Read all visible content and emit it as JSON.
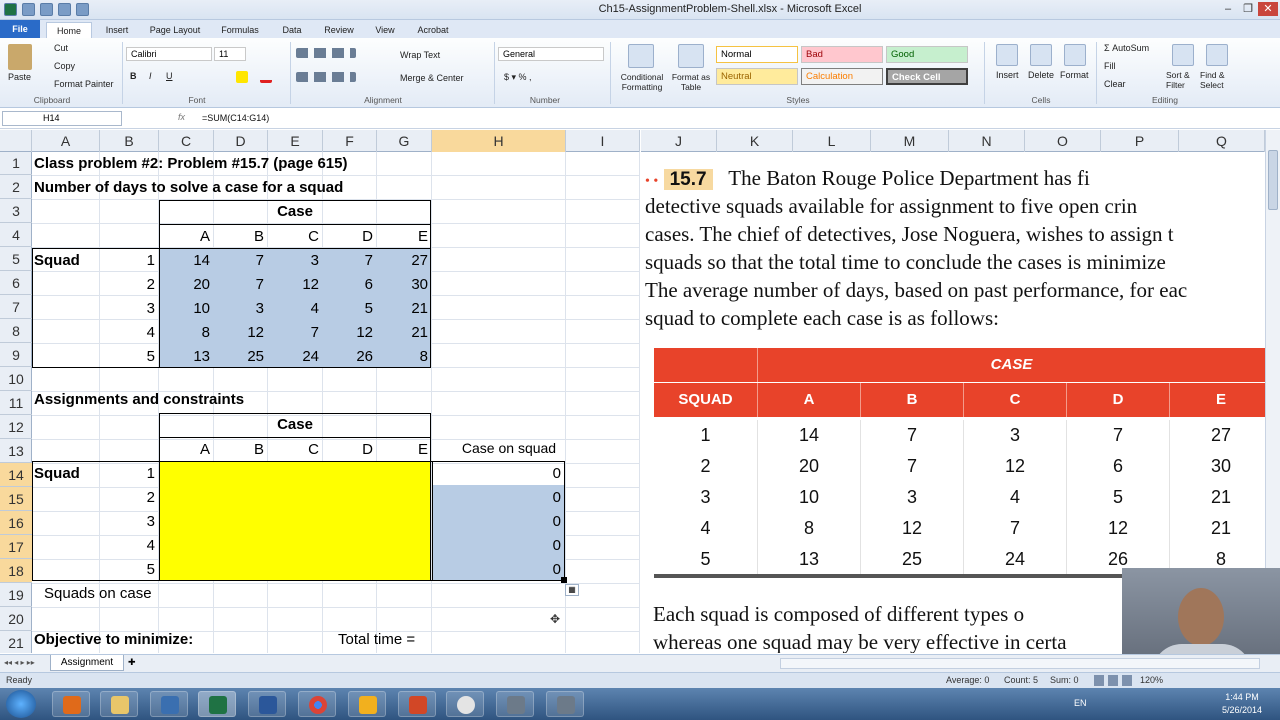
{
  "window": {
    "title": "Ch15-AssignmentProblem-Shell.xlsx - Microsoft Excel"
  },
  "tabs": [
    "File",
    "Home",
    "Insert",
    "Page Layout",
    "Formulas",
    "Data",
    "Review",
    "View",
    "Acrobat"
  ],
  "ribbon": {
    "clipboard": {
      "paste": "Paste",
      "cut": "Cut",
      "copy": "Copy",
      "format_painter": "Format Painter",
      "group": "Clipboard"
    },
    "font": {
      "name": "Calibri",
      "size": "11",
      "group": "Font"
    },
    "alignment": {
      "wrap": "Wrap Text",
      "merge": "Merge & Center",
      "group": "Alignment"
    },
    "number": {
      "format": "General",
      "group": "Number"
    },
    "styles": {
      "conditional": "Conditional Formatting",
      "format_table": "Format as Table",
      "normal": "Normal",
      "bad": "Bad",
      "good": "Good",
      "neutral": "Neutral",
      "calculation": "Calculation",
      "check_cell": "Check Cell",
      "group": "Styles"
    },
    "cells": {
      "insert": "Insert",
      "delete": "Delete",
      "format": "Format",
      "group": "Cells"
    },
    "editing": {
      "autosum": "AutoSum",
      "fill": "Fill",
      "clear": "Clear",
      "sort": "Sort & Filter",
      "find": "Find & Select",
      "group": "Editing"
    }
  },
  "formula_bar": {
    "name_box": "H14",
    "fx": "fx",
    "formula": "=SUM(C14:G14)"
  },
  "columns": [
    "A",
    "B",
    "C",
    "D",
    "E",
    "F",
    "G",
    "H",
    "I"
  ],
  "book_columns": [
    "J",
    "K",
    "L",
    "M",
    "N",
    "O",
    "P",
    "Q"
  ],
  "rows": [
    "1",
    "2",
    "3",
    "4",
    "5",
    "6",
    "7",
    "8",
    "9",
    "10",
    "11",
    "12",
    "13",
    "14",
    "15",
    "16",
    "17",
    "18",
    "19",
    "20",
    "21"
  ],
  "sheet": {
    "r1": "Class problem #2: Problem #15.7 (page 615)",
    "r2": "Number of days to solve a case for a squad",
    "case_header": "Case",
    "case_cols": [
      "A",
      "B",
      "C",
      "D",
      "E"
    ],
    "squad_label": "Squad",
    "squads": [
      "1",
      "2",
      "3",
      "4",
      "5"
    ],
    "days": [
      [
        "14",
        "7",
        "3",
        "7",
        "27"
      ],
      [
        "20",
        "7",
        "12",
        "6",
        "30"
      ],
      [
        "10",
        "3",
        "4",
        "5",
        "21"
      ],
      [
        "8",
        "12",
        "7",
        "12",
        "21"
      ],
      [
        "13",
        "25",
        "24",
        "26",
        "8"
      ]
    ],
    "r11": "Assignments and constraints",
    "case_on_squad": "Case on squad",
    "case_on_squad_values": [
      "0",
      "0",
      "0",
      "0",
      "0"
    ],
    "squads_on_case": "Squads on case",
    "objective": "Objective to minimize:",
    "total_time": "Total time ="
  },
  "book": {
    "dots": "• •",
    "problem_no": "15.7",
    "lines": [
      "The Baton Rouge Police Department has fi",
      "detective squads available for assignment to five open crin",
      "cases. The chief of detectives, Jose Noguera, wishes to assign t",
      "squads so that the total time to conclude the cases is minimize",
      "The average number of days, based on past performance, for eac",
      "squad to complete each case is as follows:"
    ],
    "table_case": "CASE",
    "table_squad": "SQUAD",
    "table_cols": [
      "A",
      "B",
      "C",
      "D",
      "E"
    ],
    "table_rows": [
      [
        "1",
        "14",
        "7",
        "3",
        "7",
        "27"
      ],
      [
        "2",
        "20",
        "7",
        "12",
        "6",
        "30"
      ],
      [
        "3",
        "10",
        "3",
        "4",
        "5",
        "21"
      ],
      [
        "4",
        "8",
        "12",
        "7",
        "12",
        "21"
      ],
      [
        "5",
        "13",
        "25",
        "24",
        "26",
        "8"
      ]
    ],
    "after1": "Each squad is composed of different types o",
    "after2": "whereas one squad may be very effective in certa"
  },
  "sheet_tab": "Assignment",
  "status": {
    "ready": "Ready",
    "average": "Average: 0",
    "count": "Count: 5",
    "sum": "Sum: 0",
    "zoom": "120%"
  },
  "taskbar": {
    "lang": "EN",
    "time": "1:44 PM",
    "date": "5/26/2014"
  }
}
